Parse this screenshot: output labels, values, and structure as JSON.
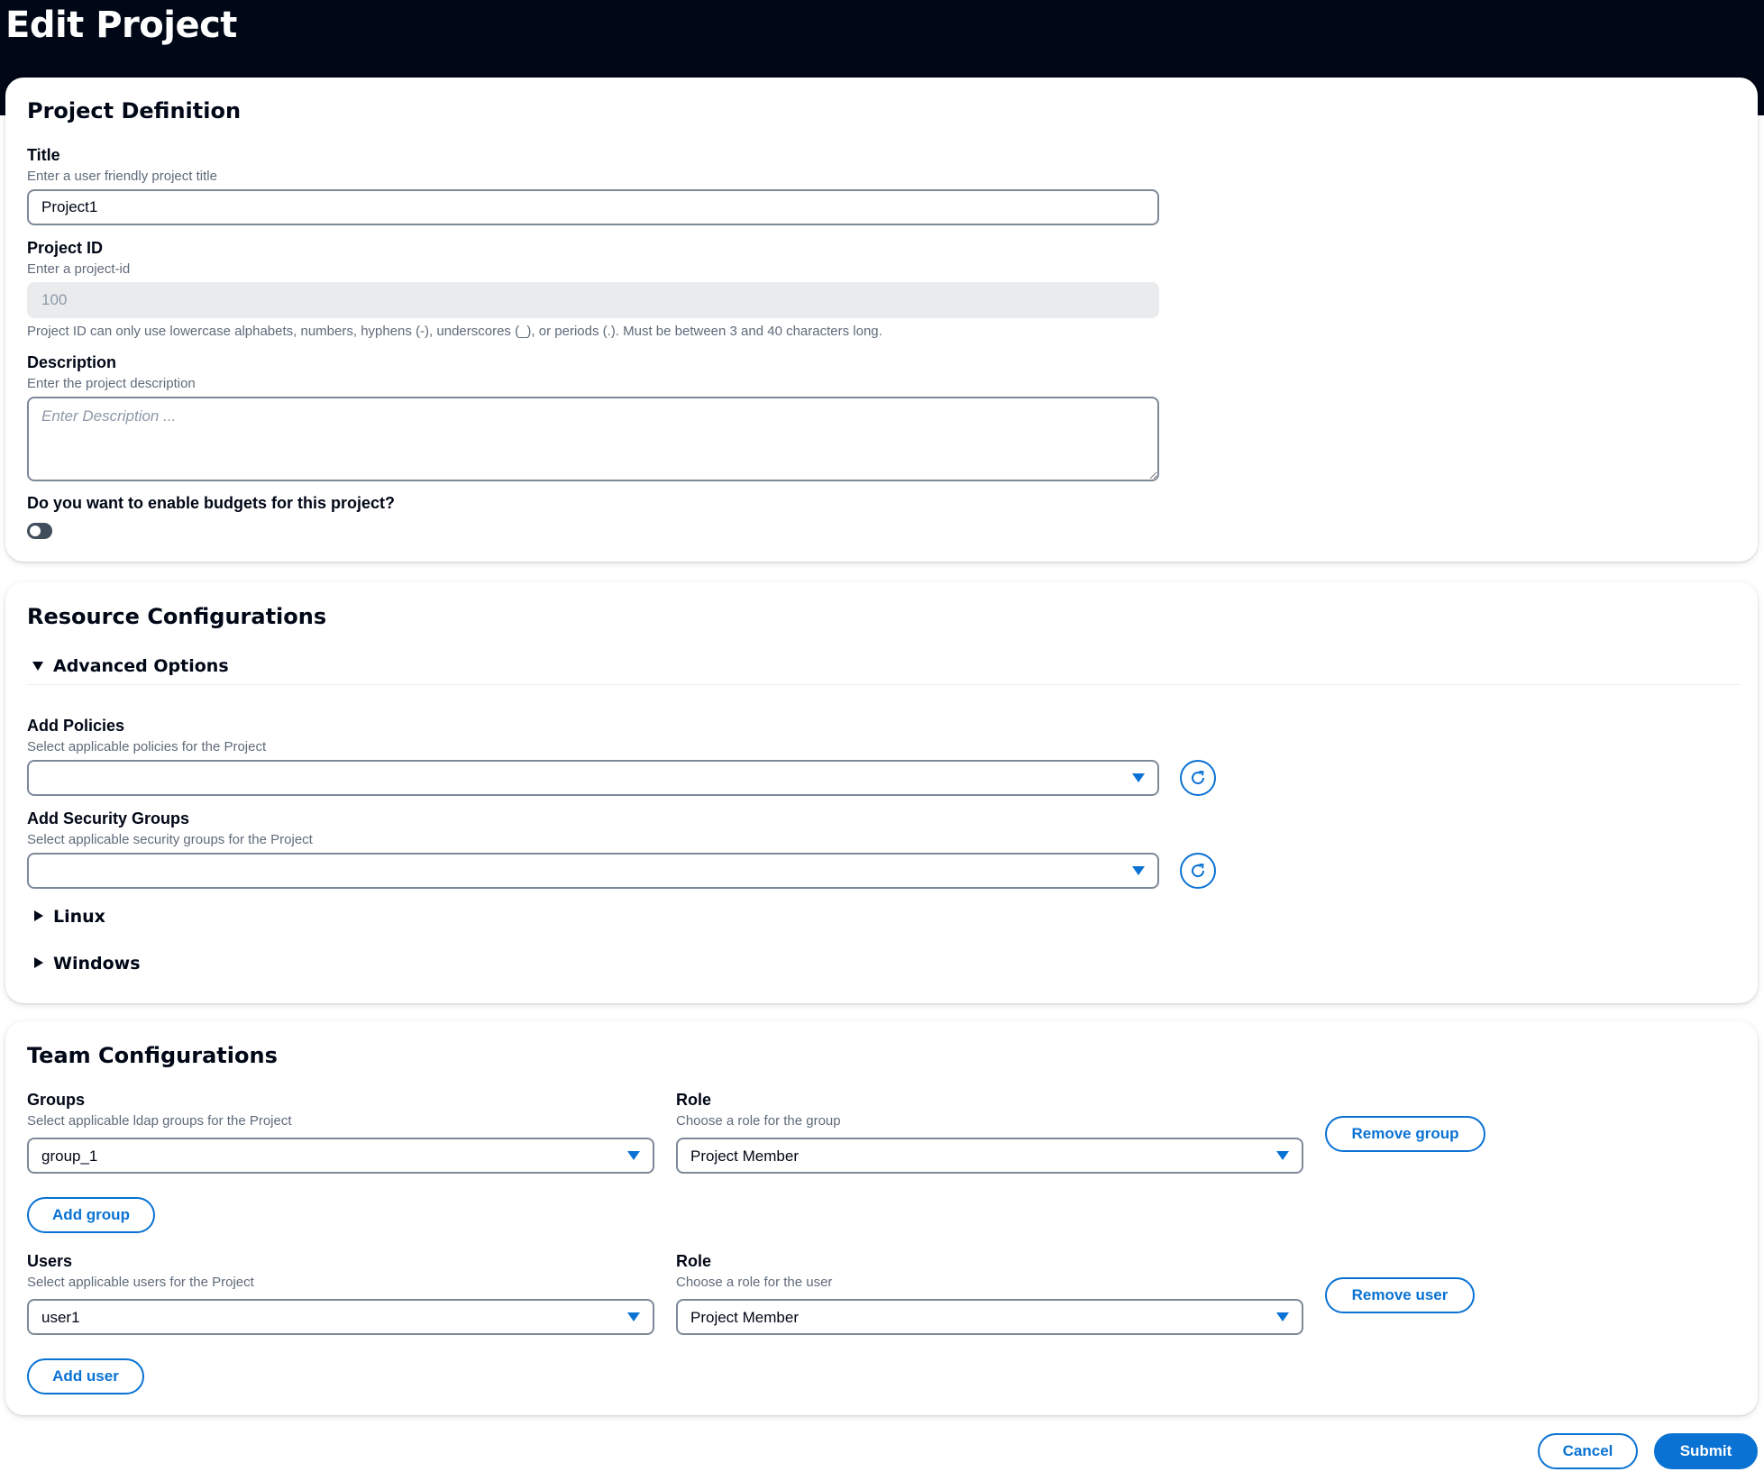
{
  "header": {
    "title": "Edit Project"
  },
  "project_definition": {
    "heading": "Project Definition",
    "title_field": {
      "label": "Title",
      "description": "Enter a user friendly project title",
      "value": "Project1"
    },
    "project_id_field": {
      "label": "Project ID",
      "description": "Enter a project-id",
      "value": "100",
      "constraint": "Project ID can only use lowercase alphabets, numbers, hyphens (-), underscores (_), or periods (.). Must be between 3 and 40 characters long."
    },
    "description_field": {
      "label": "Description",
      "description": "Enter the project description",
      "value": "",
      "placeholder": "Enter Description ..."
    },
    "budgets": {
      "label": "Do you want to enable budgets for this project?",
      "enabled": false
    }
  },
  "resource_configurations": {
    "heading": "Resource Configurations",
    "advanced_options": {
      "label": "Advanced Options",
      "expanded": true
    },
    "policies": {
      "label": "Add Policies",
      "description": "Select applicable policies for the Project",
      "value": ""
    },
    "security_groups": {
      "label": "Add Security Groups",
      "description": "Select applicable security groups for the Project",
      "value": ""
    },
    "linux": {
      "label": "Linux",
      "expanded": false
    },
    "windows": {
      "label": "Windows",
      "expanded": false
    }
  },
  "team_configurations": {
    "heading": "Team Configurations",
    "groups": {
      "label": "Groups",
      "description": "Select applicable ldap groups for the Project",
      "value": "group_1",
      "role_label": "Role",
      "role_description": "Choose a role for the group",
      "role_value": "Project Member",
      "remove_label": "Remove group",
      "add_label": "Add group"
    },
    "users": {
      "label": "Users",
      "description": "Select applicable users for the Project",
      "value": "user1",
      "role_label": "Role",
      "role_description": "Choose a role for the user",
      "role_value": "Project Member",
      "remove_label": "Remove user",
      "add_label": "Add user"
    }
  },
  "footer": {
    "cancel_label": "Cancel",
    "submit_label": "Submit"
  },
  "icons": {
    "refresh": "refresh-icon",
    "caret": "caret-down-icon",
    "expand": "triangle-icon"
  },
  "colors": {
    "header_bg": "#000716",
    "accent": "#0972d3",
    "border": "#7d8998",
    "muted_text": "#5f6b7a"
  }
}
